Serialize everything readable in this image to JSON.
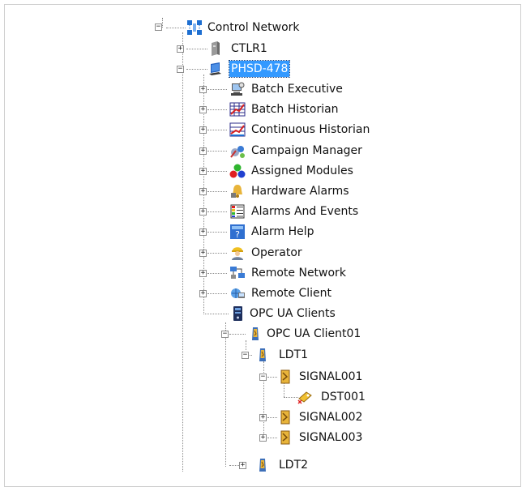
{
  "tree": {
    "control_network": "Control Network",
    "ctlr1": "CTLR1",
    "phsd": "PHSD-478",
    "children": [
      "Batch Executive",
      "Batch Historian",
      "Continuous Historian",
      "Campaign Manager",
      "Assigned Modules",
      "Hardware Alarms",
      "Alarms And Events",
      "Alarm Help",
      "Operator",
      "Remote Network",
      "Remote Client"
    ],
    "opc_ua_clients": "OPC UA Clients",
    "opc_ua_client01": "OPC UA Client01",
    "ldt1": "LDT1",
    "signal001": "SIGNAL001",
    "dst001": "DST001",
    "signal002": "SIGNAL002",
    "signal003": "SIGNAL003",
    "ldt2": "LDT2",
    "expand_glyph": "+",
    "collapse_glyph": "−"
  },
  "colors": {
    "selection": "#3399ff",
    "connector": "#8a8a8a"
  }
}
